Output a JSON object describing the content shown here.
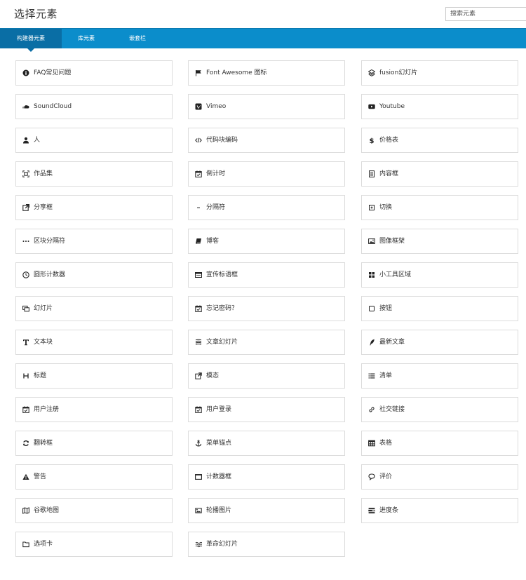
{
  "header": {
    "title": "选择元素",
    "search_placeholder": "搜索元素"
  },
  "tabs": [
    {
      "label": "构建器元素",
      "active": true
    },
    {
      "label": "库元素",
      "active": false
    },
    {
      "label": "嵌套栏",
      "active": false
    }
  ],
  "elements": [
    {
      "label": "FAQ常见问题",
      "icon": "info-circle-icon"
    },
    {
      "label": "Font Awesome 图标",
      "icon": "flag-icon"
    },
    {
      "label": "fusion幻灯片",
      "icon": "layers-icon"
    },
    {
      "label": "SoundCloud",
      "icon": "soundcloud-icon"
    },
    {
      "label": "Vimeo",
      "icon": "vimeo-icon"
    },
    {
      "label": "Youtube",
      "icon": "youtube-icon"
    },
    {
      "label": "人",
      "icon": "person-icon"
    },
    {
      "label": "代码块编码",
      "icon": "code-icon"
    },
    {
      "label": "价格表",
      "icon": "dollar-icon"
    },
    {
      "label": "作品集",
      "icon": "portfolio-icon"
    },
    {
      "label": "倒计时",
      "icon": "calendar-check-icon"
    },
    {
      "label": "内容框",
      "icon": "document-icon"
    },
    {
      "label": "分享框",
      "icon": "share-external-icon"
    },
    {
      "label": "分隔符",
      "icon": "minus-icon"
    },
    {
      "label": "切换",
      "icon": "toggle-square-icon"
    },
    {
      "label": "区块分隔符",
      "icon": "ellipsis-icon"
    },
    {
      "label": "博客",
      "icon": "book-icon"
    },
    {
      "label": "图像框架",
      "icon": "image-icon"
    },
    {
      "label": "圆形计数器",
      "icon": "clock-icon"
    },
    {
      "label": "宣传标语框",
      "icon": "banner-icon"
    },
    {
      "label": "小工具区域",
      "icon": "widgets-icon"
    },
    {
      "label": "幻灯片",
      "icon": "slides-icon"
    },
    {
      "label": "忘记密码？",
      "icon": "calendar-check-icon"
    },
    {
      "label": "按钮",
      "icon": "button-square-icon"
    },
    {
      "label": "文本块",
      "icon": "text-t-icon"
    },
    {
      "label": "文章幻灯片",
      "icon": "stack-icon"
    },
    {
      "label": "最新文章",
      "icon": "feather-icon"
    },
    {
      "label": "标题",
      "icon": "heading-h-icon"
    },
    {
      "label": "模态",
      "icon": "external-link-icon"
    },
    {
      "label": "清单",
      "icon": "list-icon"
    },
    {
      "label": "用户注册",
      "icon": "calendar-check-icon"
    },
    {
      "label": "用户登录",
      "icon": "calendar-check-icon"
    },
    {
      "label": "社交链接",
      "icon": "link-icon"
    },
    {
      "label": "翻转框",
      "icon": "flip-icon"
    },
    {
      "label": "菜单锚点",
      "icon": "anchor-icon"
    },
    {
      "label": "表格",
      "icon": "table-icon"
    },
    {
      "label": "警告",
      "icon": "warning-icon"
    },
    {
      "label": "计数器框",
      "icon": "counter-box-icon"
    },
    {
      "label": "评价",
      "icon": "comments-icon"
    },
    {
      "label": "谷歌地图",
      "icon": "map-icon"
    },
    {
      "label": "轮播图片",
      "icon": "carousel-image-icon"
    },
    {
      "label": "进度条",
      "icon": "progress-bars-icon"
    },
    {
      "label": "选项卡",
      "icon": "folder-icon"
    },
    {
      "label": "革命幻灯片",
      "icon": "waves-icon"
    }
  ]
}
